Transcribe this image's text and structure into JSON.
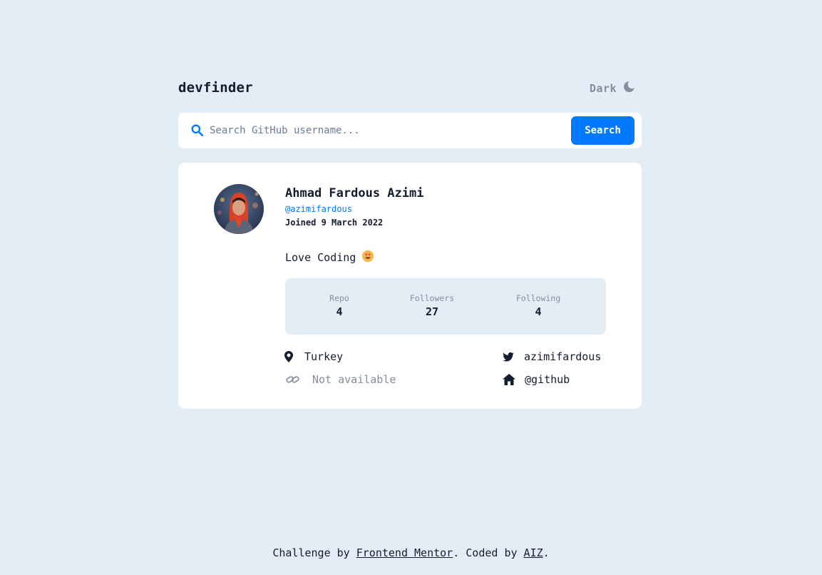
{
  "header": {
    "logo": "devfinder",
    "theme_label": "Dark",
    "theme_icon": "moon-icon"
  },
  "search": {
    "placeholder": "Search GitHub username...",
    "value": "",
    "button_label": "Search",
    "icon": "search-icon"
  },
  "profile": {
    "name": "Ahmad Fardous Azimi",
    "login": "@azimifardous",
    "joined": "Joined 9 March 2022",
    "bio": "Love Coding",
    "bio_emoji": "😍",
    "stats": [
      {
        "label": "Repo",
        "value": "4"
      },
      {
        "label": "Followers",
        "value": "27"
      },
      {
        "label": "Following",
        "value": "4"
      }
    ],
    "links": {
      "location": {
        "text": "Turkey",
        "icon": "location-pin-icon"
      },
      "website": {
        "text": "Not available",
        "icon": "link-icon"
      },
      "twitter": {
        "text": "azimifardous",
        "icon": "twitter-icon"
      },
      "company": {
        "text": "@github",
        "icon": "building-icon"
      }
    }
  },
  "footer": {
    "prefix": "Challenge by",
    "challenge_link": "Frontend Mentor",
    "middle": ". Coded by",
    "author_link": "AIZ",
    "suffix": "."
  },
  "colors": {
    "background": "#e2edf5",
    "card": "#ffffff",
    "accent": "#0079ff",
    "text": "#141d2f",
    "muted": "#848e9f"
  }
}
